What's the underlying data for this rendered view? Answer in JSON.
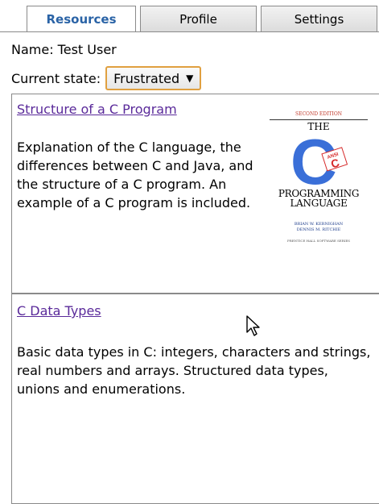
{
  "tabs": [
    {
      "label": "Resources",
      "active": true
    },
    {
      "label": "Profile",
      "active": false
    },
    {
      "label": "Settings",
      "active": false
    }
  ],
  "user": {
    "name_text": "Name: Test User",
    "state_label": "Current state:",
    "state_value": "Frustrated"
  },
  "resources": [
    {
      "title": "Structure of a C Program",
      "description": "Explanation of the C language, the differences between C and Java, and the structure of a C program. An example of a C program is included.",
      "cover": {
        "edition": "SECOND EDITION",
        "the": "THE",
        "letter": "C",
        "ansi": "ANSI",
        "title_line1": "PROGRAMMING",
        "title_line2": "LANGUAGE",
        "author1": "BRIAN W. KERNIGHAN",
        "author2": "DENNIS M. RITCHIE",
        "publisher": "PRENTICE HALL SOFTWARE SERIES"
      }
    },
    {
      "title": "C Data Types",
      "description": "Basic data types in C: integers, characters and strings, real numbers and arrays. Structured data types, unions and enumerations."
    }
  ],
  "colors": {
    "active_tab_text": "#2a63a6",
    "link": "#5a2a9a",
    "select_border": "#e0a040",
    "cover_blue": "#3a6fd8",
    "cover_red": "#d62a2a"
  }
}
